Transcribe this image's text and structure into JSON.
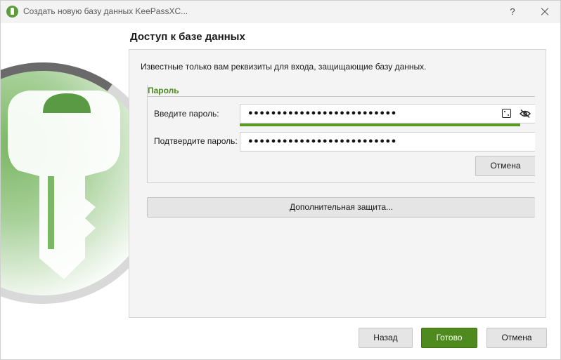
{
  "window": {
    "title": "Создать новую базу данных KeePassXC...",
    "help_label": "?"
  },
  "page": {
    "heading": "Доступ к базе данных",
    "description": "Известные только вам реквизиты для входа, защищающие базу данных."
  },
  "password_group": {
    "title": "Пароль",
    "enter_label": "Введите пароль:",
    "enter_value": "●●●●●●●●●●●●●●●●●●●●●●●●●●",
    "confirm_label": "Подтвердите пароль:",
    "confirm_value": "●●●●●●●●●●●●●●●●●●●●●●●●●●",
    "strength_fraction": 0.95,
    "strength_color": "#5b9a22",
    "cancel_label": "Отмена",
    "icons": [
      "dice-icon",
      "eye-off-icon"
    ]
  },
  "advanced_label": "Дополнительная защита...",
  "footer": {
    "back_label": "Назад",
    "done_label": "Готово",
    "cancel_label": "Отмена"
  },
  "colors": {
    "accent": "#4f8a1e",
    "group_title": "#4a8a1f"
  }
}
